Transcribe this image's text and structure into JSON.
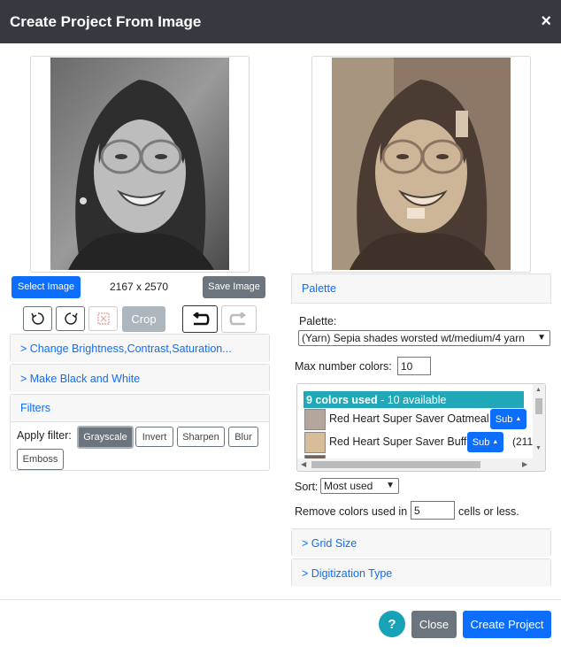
{
  "header": {
    "title": "Create Project From Image",
    "close_glyph": "×"
  },
  "left": {
    "dimensions": "2167 x 2570",
    "select_image_label": "Select Image",
    "save_image_label": "Save Image",
    "crop_label": "Crop",
    "sections": {
      "brightness": "> Change Brightness,Contrast,Saturation...",
      "black_white": "> Make Black and White",
      "filters": "Filters"
    },
    "apply_filter_label": "Apply filter:",
    "filters": [
      "Grayscale",
      "Invert",
      "Sharpen",
      "Blur",
      "Emboss"
    ],
    "active_filter": "Grayscale"
  },
  "palette": {
    "header": "Palette",
    "palette_label": "Palette:",
    "palette_value": "(Yarn) Sepia shades worsted wt/medium/4 yarn",
    "max_colors_label": "Max number colors:",
    "max_colors_value": "10",
    "used_count": "9 colors used",
    "available": "- 10 available",
    "colors": [
      {
        "name": "Red Heart Super Saver Oatmeal",
        "sub": "Sub",
        "extra": "",
        "hex": "#b4a69a"
      },
      {
        "name": "Red Heart Super Saver Buff",
        "sub": "Sub",
        "extra": "(211",
        "hex": "#d7bd9a"
      }
    ],
    "sort_label": "Sort:",
    "sort_value": "Most used",
    "remove_prefix": "Remove colors used in",
    "remove_value": "5",
    "remove_suffix": "cells or less."
  },
  "sections": {
    "grid_size": "> Grid Size",
    "digitization": "> Digitization Type"
  },
  "footer": {
    "help": "?",
    "close": "Close",
    "create": "Create Project"
  },
  "colors": {
    "header_bg": "#343a40",
    "primary": "#0d6efd",
    "secondary": "#6c757d",
    "teal": "#17a2b8",
    "used_bar": "#20a8b8"
  }
}
